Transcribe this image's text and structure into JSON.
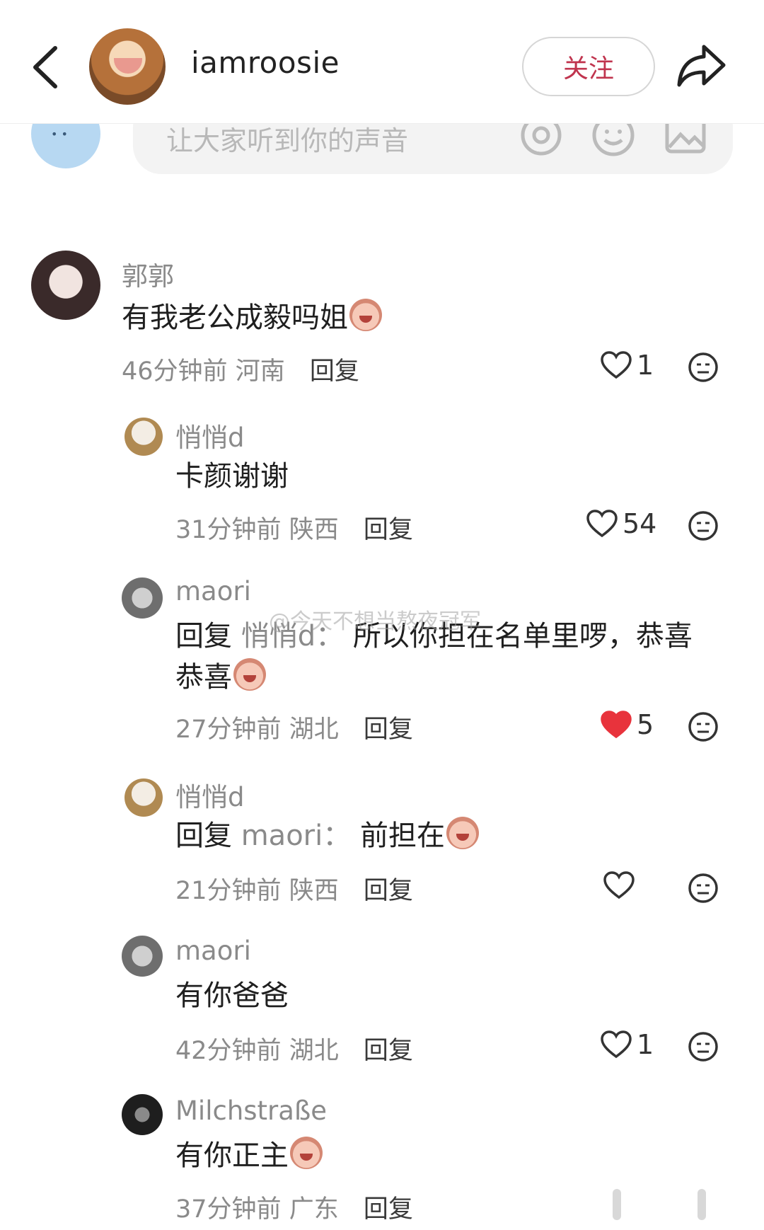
{
  "header": {
    "username": "iamroosie",
    "follow_label": "关注"
  },
  "input": {
    "placeholder": "让大家听到你的声音"
  },
  "watermark": "@今天不想当熬夜冠军",
  "comments": [
    {
      "name": "郭郭",
      "text": "有我老公成毅吗姐",
      "time": "46分钟前",
      "location": "河南",
      "reply_label": "回复",
      "likes": "1",
      "liked": false
    },
    {
      "name": "悄悄d",
      "text": "卡颜谢谢",
      "time": "31分钟前",
      "location": "陕西",
      "reply_label": "回复",
      "likes": "54",
      "liked": false
    },
    {
      "name": "maori",
      "reply_prefix": "回复",
      "reply_to": "悄悄d：",
      "text_line1": "所以你担在名单里啰，恭喜",
      "text_line2": "恭喜",
      "time": "27分钟前",
      "location": "湖北",
      "reply_label": "回复",
      "likes": "5",
      "liked": true
    },
    {
      "name": "悄悄d",
      "reply_prefix": "回复",
      "reply_to": "maori：",
      "text": "前担在",
      "time": "21分钟前",
      "location": "陕西",
      "reply_label": "回复",
      "likes": "",
      "liked": false
    },
    {
      "name": "maori",
      "text": "有你爸爸",
      "time": "42分钟前",
      "location": "湖北",
      "reply_label": "回复",
      "likes": "1",
      "liked": false
    },
    {
      "name": "Milchstraße",
      "text": "有你正主",
      "time": "37分钟前",
      "location": "广东",
      "reply_label": "回复"
    }
  ],
  "colors": {
    "accent": "#c0344e",
    "liked_heart": "#e8333c",
    "secondary_text": "#8a8a8a"
  }
}
